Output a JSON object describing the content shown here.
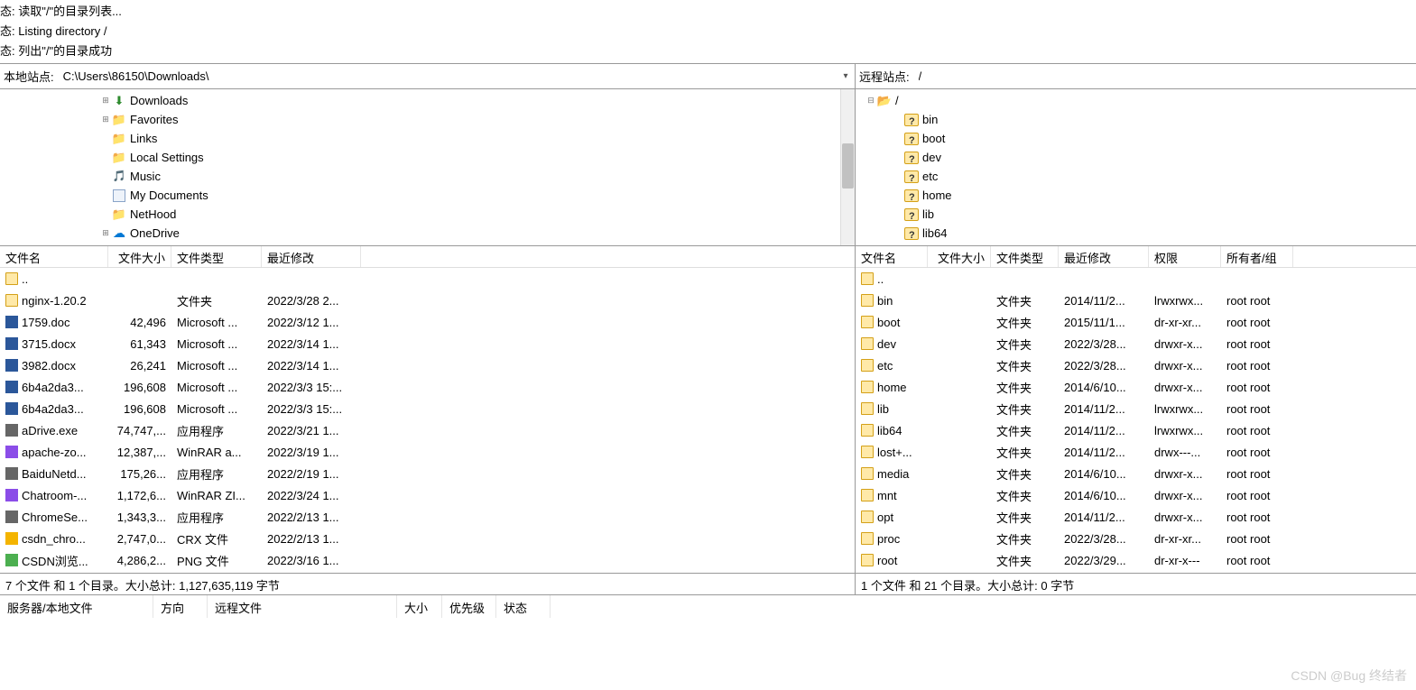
{
  "status_log": [
    "态:  读取\"/\"的目录列表...",
    "态:  Listing directory /",
    "态:  列出\"/\"的目录成功"
  ],
  "local": {
    "label": "本地站点:",
    "path": "C:\\Users\\86150\\Downloads\\",
    "tree": [
      {
        "indent": 110,
        "exp": "plus",
        "icon": "dl",
        "label": "Downloads"
      },
      {
        "indent": 110,
        "exp": "plus",
        "icon": "folder",
        "label": "Favorites"
      },
      {
        "indent": 110,
        "exp": "none",
        "icon": "folder",
        "label": "Links"
      },
      {
        "indent": 110,
        "exp": "none",
        "icon": "folder",
        "label": "Local Settings"
      },
      {
        "indent": 110,
        "exp": "none",
        "icon": "music",
        "label": "Music"
      },
      {
        "indent": 110,
        "exp": "none",
        "icon": "doc",
        "label": "My Documents"
      },
      {
        "indent": 110,
        "exp": "none",
        "icon": "folder",
        "label": "NetHood"
      },
      {
        "indent": 110,
        "exp": "plus",
        "icon": "cloud",
        "label": "OneDrive"
      }
    ],
    "columns": {
      "name": "文件名",
      "size": "文件大小",
      "type": "文件类型",
      "modified": "最近修改"
    },
    "col_widths": {
      "name": 120,
      "size": 70,
      "type": 100,
      "modified": 110
    },
    "files": [
      {
        "icon": "folder",
        "name": "..",
        "size": "",
        "type": "",
        "modified": ""
      },
      {
        "icon": "folder",
        "name": "nginx-1.20.2",
        "size": "",
        "type": "文件夹",
        "modified": "2022/3/28 2..."
      },
      {
        "icon": "doc",
        "name": "1759.doc",
        "size": "42,496",
        "type": "Microsoft ...",
        "modified": "2022/3/12 1..."
      },
      {
        "icon": "doc",
        "name": "3715.docx",
        "size": "61,343",
        "type": "Microsoft ...",
        "modified": "2022/3/14 1..."
      },
      {
        "icon": "doc",
        "name": "3982.docx",
        "size": "26,241",
        "type": "Microsoft ...",
        "modified": "2022/3/14 1..."
      },
      {
        "icon": "doc",
        "name": "6b4a2da3...",
        "size": "196,608",
        "type": "Microsoft ...",
        "modified": "2022/3/3 15:..."
      },
      {
        "icon": "doc",
        "name": "6b4a2da3...",
        "size": "196,608",
        "type": "Microsoft ...",
        "modified": "2022/3/3 15:..."
      },
      {
        "icon": "exe",
        "name": "aDrive.exe",
        "size": "74,747,...",
        "type": "应用程序",
        "modified": "2022/3/21 1..."
      },
      {
        "icon": "rar",
        "name": "apache-zo...",
        "size": "12,387,...",
        "type": "WinRAR a...",
        "modified": "2022/3/19 1..."
      },
      {
        "icon": "exe",
        "name": "BaiduNetd...",
        "size": "175,26...",
        "type": "应用程序",
        "modified": "2022/2/19 1..."
      },
      {
        "icon": "rar",
        "name": "Chatroom-...",
        "size": "1,172,6...",
        "type": "WinRAR ZI...",
        "modified": "2022/3/24 1..."
      },
      {
        "icon": "exe",
        "name": "ChromeSe...",
        "size": "1,343,3...",
        "type": "应用程序",
        "modified": "2022/2/13 1..."
      },
      {
        "icon": "crx",
        "name": "csdn_chro...",
        "size": "2,747,0...",
        "type": "CRX 文件",
        "modified": "2022/2/13 1..."
      },
      {
        "icon": "png",
        "name": "CSDN浏览...",
        "size": "4,286,2...",
        "type": "PNG 文件",
        "modified": "2022/3/16 1..."
      }
    ],
    "footer": "7 个文件 和 1 个目录。大小总计: 1,127,635,119 字节"
  },
  "remote": {
    "label": "远程站点:",
    "path": "/",
    "tree": [
      {
        "indent": 10,
        "exp": "minus",
        "icon": "folder-open",
        "label": "/"
      },
      {
        "indent": 40,
        "exp": "none",
        "icon": "unk",
        "label": "bin"
      },
      {
        "indent": 40,
        "exp": "none",
        "icon": "unk",
        "label": "boot"
      },
      {
        "indent": 40,
        "exp": "none",
        "icon": "unk",
        "label": "dev"
      },
      {
        "indent": 40,
        "exp": "none",
        "icon": "unk",
        "label": "etc"
      },
      {
        "indent": 40,
        "exp": "none",
        "icon": "unk",
        "label": "home"
      },
      {
        "indent": 40,
        "exp": "none",
        "icon": "unk",
        "label": "lib"
      },
      {
        "indent": 40,
        "exp": "none",
        "icon": "unk",
        "label": "lib64"
      }
    ],
    "columns": {
      "name": "文件名",
      "size": "文件大小",
      "type": "文件类型",
      "modified": "最近修改",
      "perm": "权限",
      "owner": "所有者/组"
    },
    "col_widths": {
      "name": 80,
      "size": 70,
      "type": 75,
      "modified": 100,
      "perm": 80,
      "owner": 80
    },
    "files": [
      {
        "icon": "folder",
        "name": "..",
        "size": "",
        "type": "",
        "modified": "",
        "perm": "",
        "owner": ""
      },
      {
        "icon": "link",
        "name": "bin",
        "size": "",
        "type": "文件夹",
        "modified": "2014/11/2...",
        "perm": "lrwxrwx...",
        "owner": "root root"
      },
      {
        "icon": "folder",
        "name": "boot",
        "size": "",
        "type": "文件夹",
        "modified": "2015/11/1...",
        "perm": "dr-xr-xr...",
        "owner": "root root"
      },
      {
        "icon": "folder",
        "name": "dev",
        "size": "",
        "type": "文件夹",
        "modified": "2022/3/28...",
        "perm": "drwxr-x...",
        "owner": "root root"
      },
      {
        "icon": "folder",
        "name": "etc",
        "size": "",
        "type": "文件夹",
        "modified": "2022/3/28...",
        "perm": "drwxr-x...",
        "owner": "root root"
      },
      {
        "icon": "folder",
        "name": "home",
        "size": "",
        "type": "文件夹",
        "modified": "2014/6/10...",
        "perm": "drwxr-x...",
        "owner": "root root"
      },
      {
        "icon": "link",
        "name": "lib",
        "size": "",
        "type": "文件夹",
        "modified": "2014/11/2...",
        "perm": "lrwxrwx...",
        "owner": "root root"
      },
      {
        "icon": "link",
        "name": "lib64",
        "size": "",
        "type": "文件夹",
        "modified": "2014/11/2...",
        "perm": "lrwxrwx...",
        "owner": "root root"
      },
      {
        "icon": "folder",
        "name": "lost+...",
        "size": "",
        "type": "文件夹",
        "modified": "2014/11/2...",
        "perm": "drwx---...",
        "owner": "root root"
      },
      {
        "icon": "folder",
        "name": "media",
        "size": "",
        "type": "文件夹",
        "modified": "2014/6/10...",
        "perm": "drwxr-x...",
        "owner": "root root"
      },
      {
        "icon": "folder",
        "name": "mnt",
        "size": "",
        "type": "文件夹",
        "modified": "2014/6/10...",
        "perm": "drwxr-x...",
        "owner": "root root"
      },
      {
        "icon": "folder",
        "name": "opt",
        "size": "",
        "type": "文件夹",
        "modified": "2014/11/2...",
        "perm": "drwxr-x...",
        "owner": "root root"
      },
      {
        "icon": "folder",
        "name": "proc",
        "size": "",
        "type": "文件夹",
        "modified": "2022/3/28...",
        "perm": "dr-xr-xr...",
        "owner": "root root"
      },
      {
        "icon": "folder",
        "name": "root",
        "size": "",
        "type": "文件夹",
        "modified": "2022/3/29...",
        "perm": "dr-xr-x---",
        "owner": "root root"
      }
    ],
    "footer": "1 个文件 和 21 个目录。大小总计: 0 字节"
  },
  "queue": {
    "server": "服务器/本地文件",
    "dir": "方向",
    "remote": "远程文件",
    "size": "大小",
    "pri": "优先级",
    "status": "状态"
  },
  "watermark": "CSDN @Bug 终结者"
}
